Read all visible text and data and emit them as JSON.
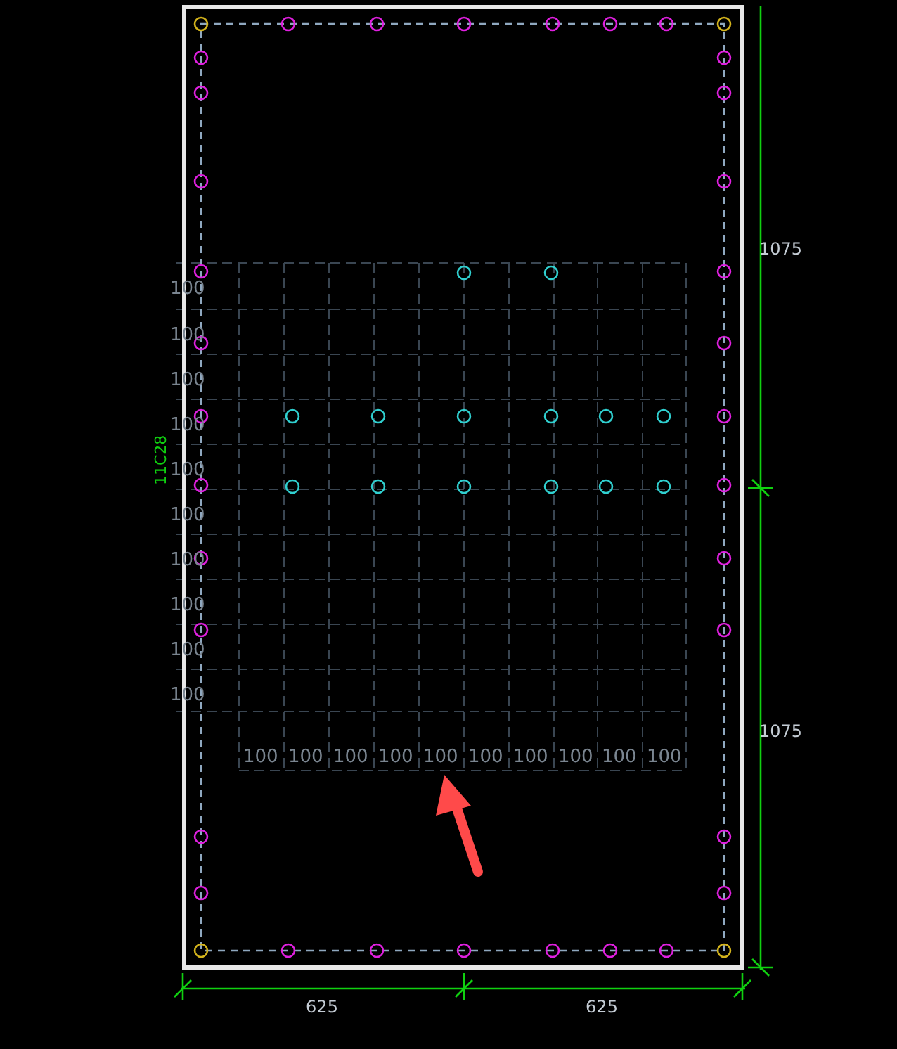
{
  "canvas": {
    "section_label": "11C28",
    "vertical_dimensions": [
      "1075",
      "1075"
    ],
    "horizontal_dimensions": [
      "625",
      "625"
    ],
    "grid_row_labels": [
      "100",
      "100",
      "100",
      "100",
      "100",
      "100",
      "100",
      "100",
      "100",
      "100"
    ],
    "grid_column_labels": [
      "100",
      "100",
      "100",
      "100",
      "100",
      "100",
      "100",
      "100",
      "100",
      "100"
    ],
    "marker_groups": [
      {
        "kind": "corner",
        "color": "#d4b41c"
      },
      {
        "kind": "edge",
        "color": "#e020e0"
      },
      {
        "kind": "inner",
        "color": "#30d0d0"
      }
    ],
    "annotation": {
      "kind": "arrow"
    }
  }
}
